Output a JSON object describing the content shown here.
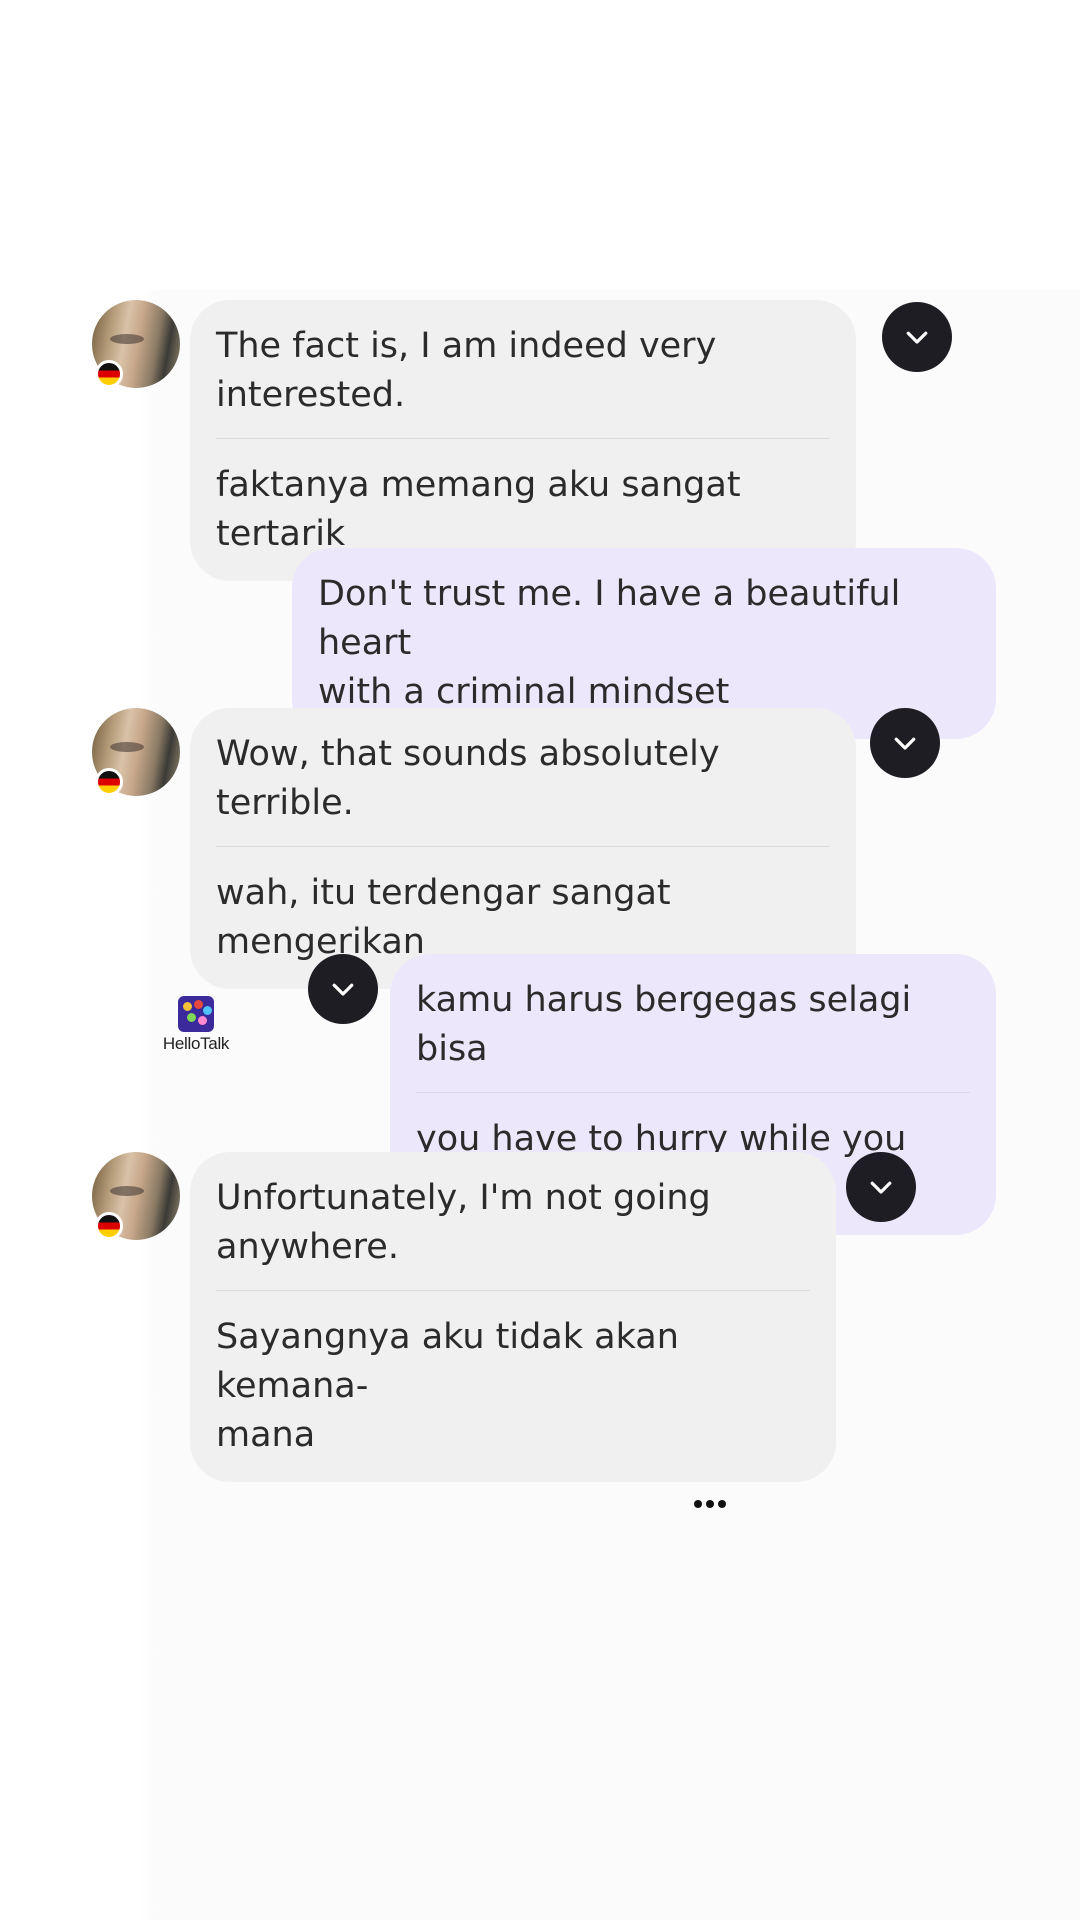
{
  "app": {
    "watermark": "HelloTalk"
  },
  "messages": [
    {
      "direction": "incoming",
      "text_lines": [
        "The fact is, I am indeed very",
        "interested."
      ],
      "translation_lines": [
        "faktanya memang aku sangat tertarik"
      ],
      "avatar_flag": "germany-flag"
    },
    {
      "direction": "outgoing",
      "text_lines": [
        "Don't trust me. I have a beautiful heart",
        "with a criminal mindset"
      ]
    },
    {
      "direction": "incoming",
      "text_lines": [
        "Wow, that sounds absolutely terrible."
      ],
      "translation_lines": [
        "wah, itu terdengar sangat",
        "mengerikan"
      ],
      "avatar_flag": "germany-flag"
    },
    {
      "direction": "outgoing",
      "text_lines": [
        "kamu harus bergegas selagi bisa"
      ],
      "translation_lines": [
        "you have to hurry while you can"
      ]
    },
    {
      "direction": "incoming",
      "text_lines": [
        "Unfortunately, I'm not going",
        "anywhere."
      ],
      "translation_lines": [
        "Sayangnya aku tidak akan kemana-",
        "mana"
      ],
      "avatar_flag": "germany-flag"
    }
  ],
  "colors": {
    "incoming_bubble": "#f1f0f1",
    "outgoing_bubble": "#ede7fb",
    "menu_button": "#1f1d24"
  },
  "icons": {
    "message_menu": "chevron-down-icon",
    "typing": "more-dots-icon"
  }
}
